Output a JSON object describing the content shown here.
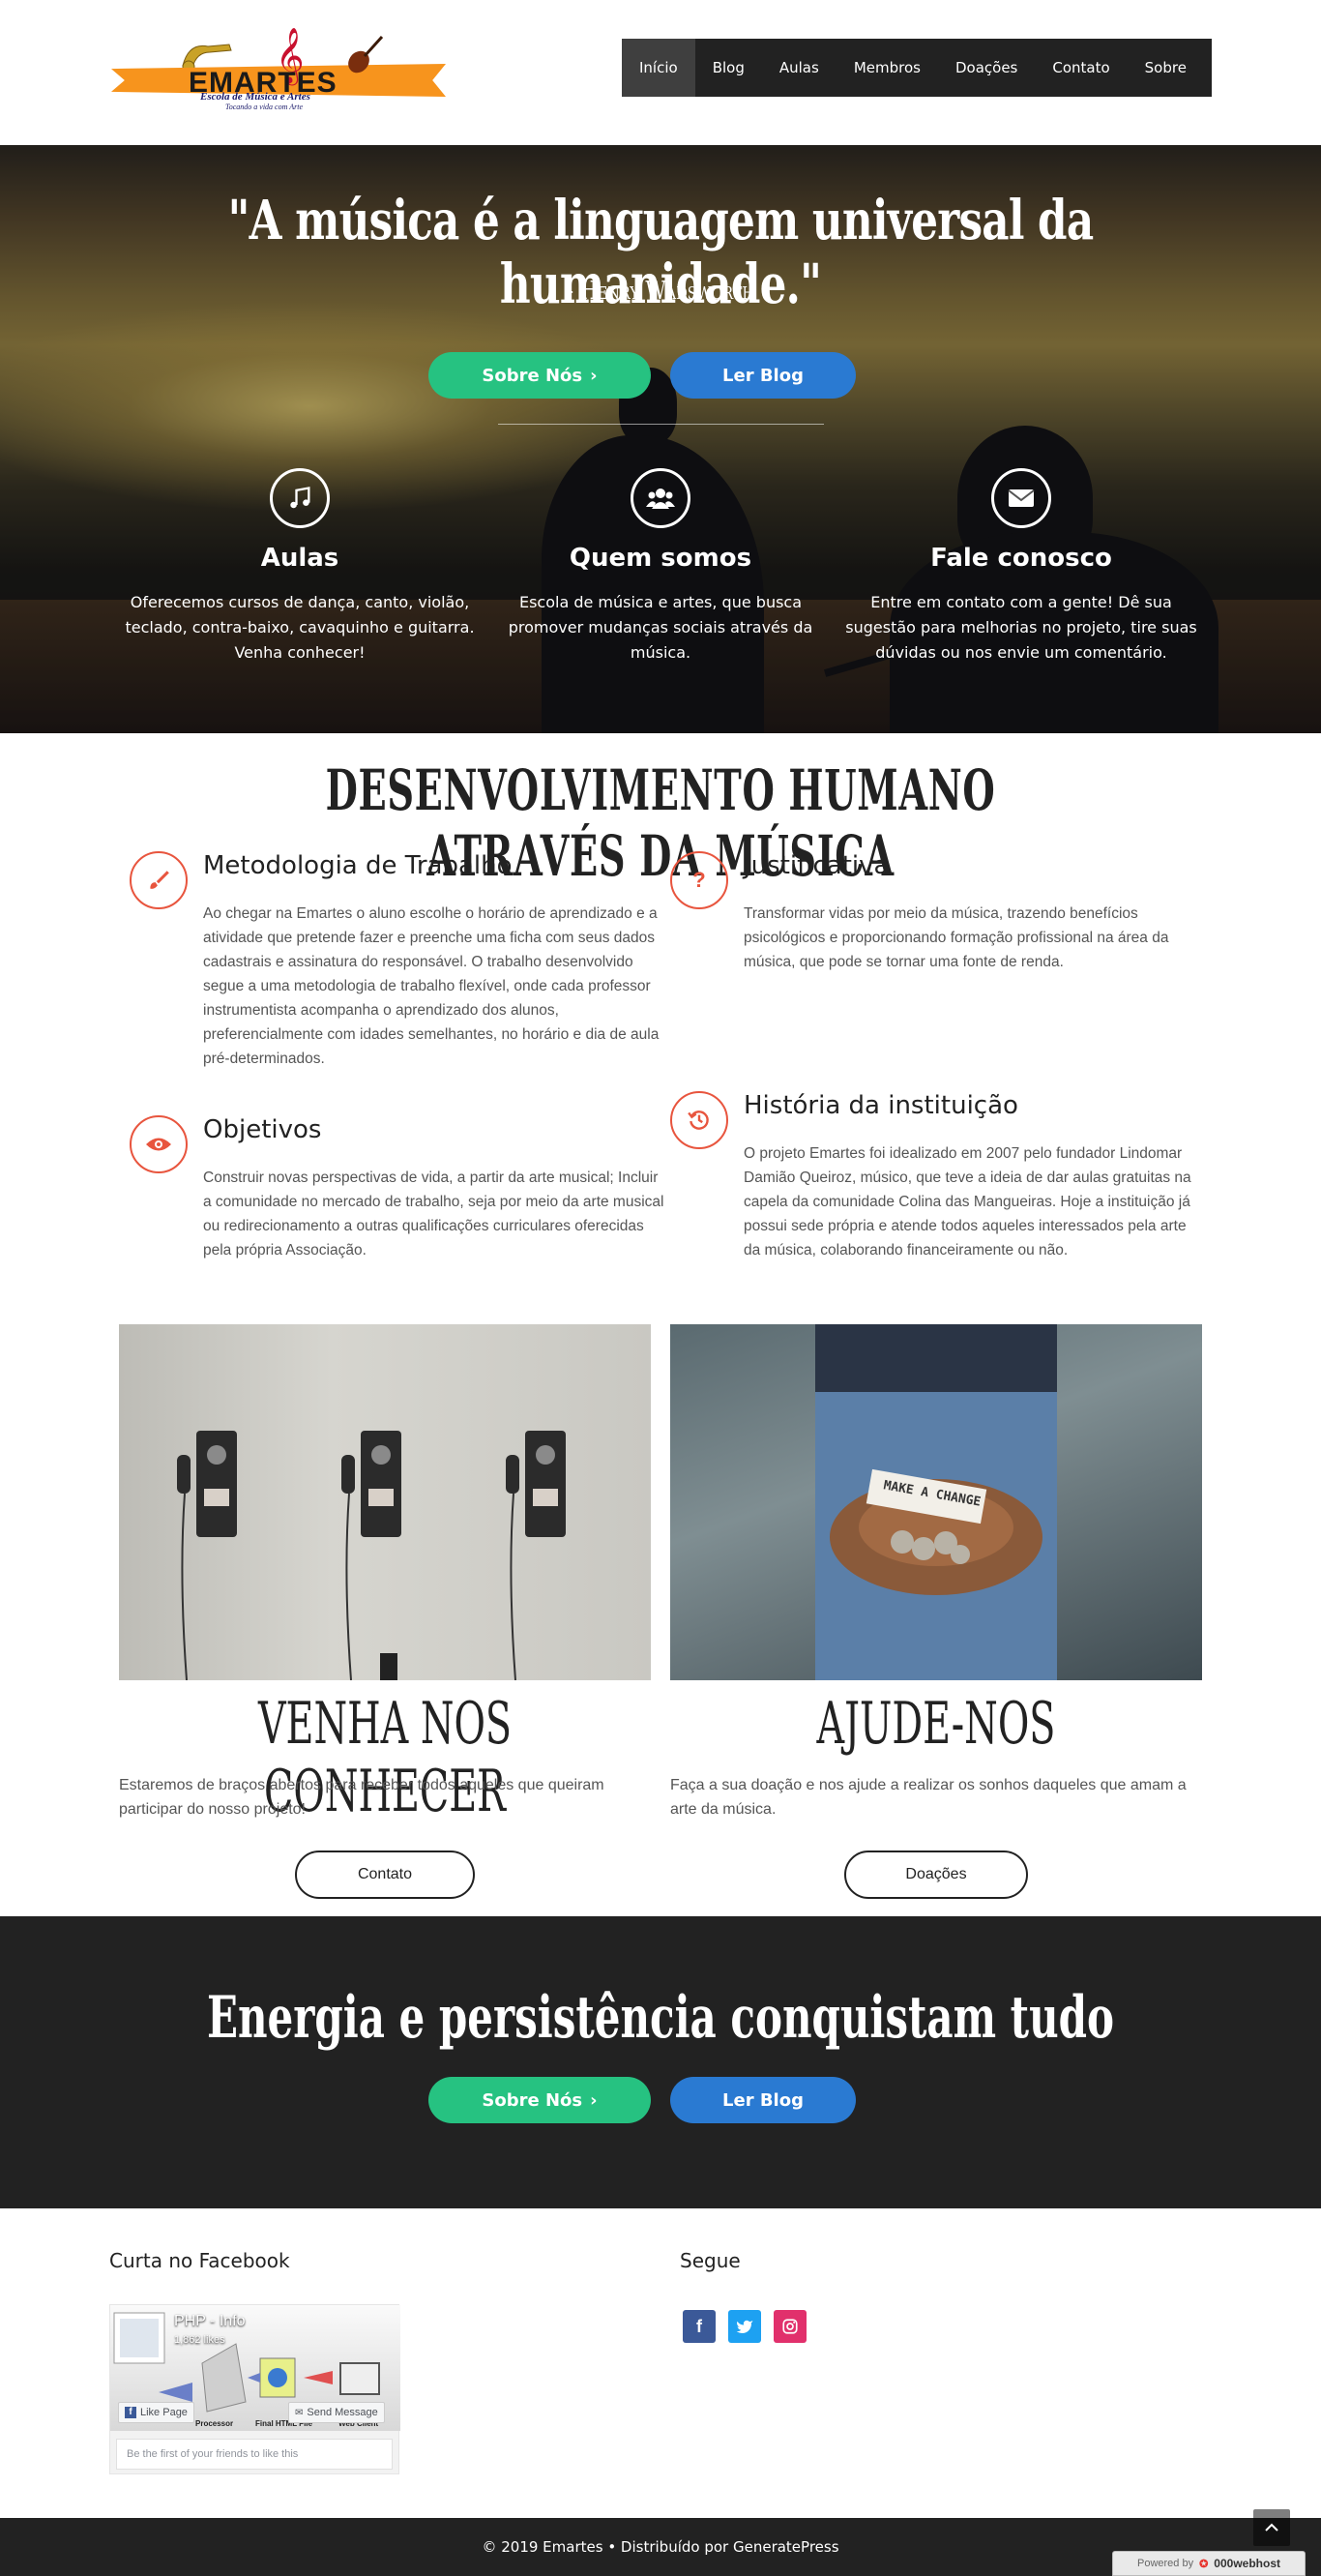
{
  "header": {
    "logo_title": "EMARTES",
    "logo_subtitle": "Escola de Música e Artes",
    "logo_tagline": "Tocando a vida com Arte",
    "nav": [
      "Início",
      "Blog",
      "Aulas",
      "Membros",
      "Doações",
      "Contato",
      "Sobre"
    ]
  },
  "hero": {
    "quote": "\"A música é a linguagem universal da humanidade.\"",
    "author": "- Henry Wadsworth",
    "btn_about": "Sobre Nós",
    "btn_blog": "Ler Blog",
    "features": [
      {
        "icon": "music-note-icon",
        "title": "Aulas",
        "text": "Oferecemos cursos de dança, canto, violão, teclado, contra-baixo, cavaquinho e guitarra. Venha conhecer!"
      },
      {
        "icon": "users-icon",
        "title": "Quem somos",
        "text": "Escola de música e artes, que busca promover mudanças sociais através da música."
      },
      {
        "icon": "envelope-icon",
        "title": "Fale conosco",
        "text": "Entre em contato com a gente! Dê sua sugestão para melhorias no projeto, tire suas dúvidas ou nos envie um comentário."
      }
    ]
  },
  "development": {
    "title": "DESENVOLVIMENTO HUMANO ATRAVÉS DA MÚSICA",
    "items": [
      {
        "icon": "paintbrush-icon",
        "title": "Metodologia de Trabalho",
        "text": "Ao chegar na Emartes o aluno escolhe o horário de aprendizado e a atividade que pretende fazer e preenche uma ficha com seus dados cadastrais e assinatura do responsável. O trabalho desenvolvido segue a uma metodologia de trabalho flexível, onde cada professor instrumentista acompanha o aprendizado dos alunos, preferencialmente com idades semelhantes, no horário e dia de aula pré-determinados."
      },
      {
        "icon": "question-icon",
        "title": "Justificativa",
        "text": "Transformar vidas por meio da música, trazendo benefícios psicológicos e proporcionando formação profissional na área da música, que pode se tornar uma fonte de renda."
      },
      {
        "icon": "eye-icon",
        "title": "Objetivos",
        "text": "Construir novas perspectivas de vida, a partir da arte musical; Incluir a comunidade no mercado de trabalho, seja por meio da arte musical ou redirecionamento a outras qualificações curriculares oferecidas pela própria Associação."
      },
      {
        "icon": "history-icon",
        "title": "História da instituição",
        "text": "O projeto Emartes foi idealizado em 2007 pelo fundador Lindomar Damião Queiroz, músico, que teve a ideia de dar aulas gratuitas na capela da comunidade Colina das Mangueiras. Hoje a instituição já possui sede própria e atende todos aqueles interessados pela arte da música, colaborando financeiramente ou não."
      }
    ]
  },
  "cards": [
    {
      "title": "VENHA NOS CONHECER",
      "text": "Estaremos de braços abertos para receber todos aqueles que queiram participar do nosso projeto!",
      "button": "Contato"
    },
    {
      "title": "AJUDE-NOS",
      "text": "Faça a sua doação e nos ajude a realizar os sonhos daqueles que amam a arte da música.",
      "button": "Doações",
      "photo_note": "MAKE A CHANGE"
    }
  ],
  "band": {
    "title": "Energia e persistência conquistam tudo",
    "btn_about": "Sobre Nós",
    "btn_blog": "Ler Blog"
  },
  "footer": {
    "facebook_title": "Curta no Facebook",
    "fb_page_name": "PHP - Info",
    "fb_likes": "1,862 likes",
    "fb_like_btn": "Like Page",
    "fb_msg_btn": "Send Message",
    "fb_diagram_labels": [
      "Processor",
      "Final HTML File",
      "Web Client"
    ],
    "fb_friends": "Be the first of your friends to like this",
    "follow_title": "Segue",
    "social": [
      {
        "name": "facebook",
        "color": "#3b5998"
      },
      {
        "name": "twitter",
        "color": "#1da1f2"
      },
      {
        "name": "instagram",
        "color": "#e1306c"
      }
    ],
    "copyright": "© 2019 Emartes • Distribuído por GeneratePress",
    "powered_prefix": "Powered by",
    "powered_brand": "000webhost"
  },
  "colors": {
    "accent": "#e8553e",
    "green": "#26c281",
    "blue": "#2a7ad2",
    "dark": "#222222"
  }
}
